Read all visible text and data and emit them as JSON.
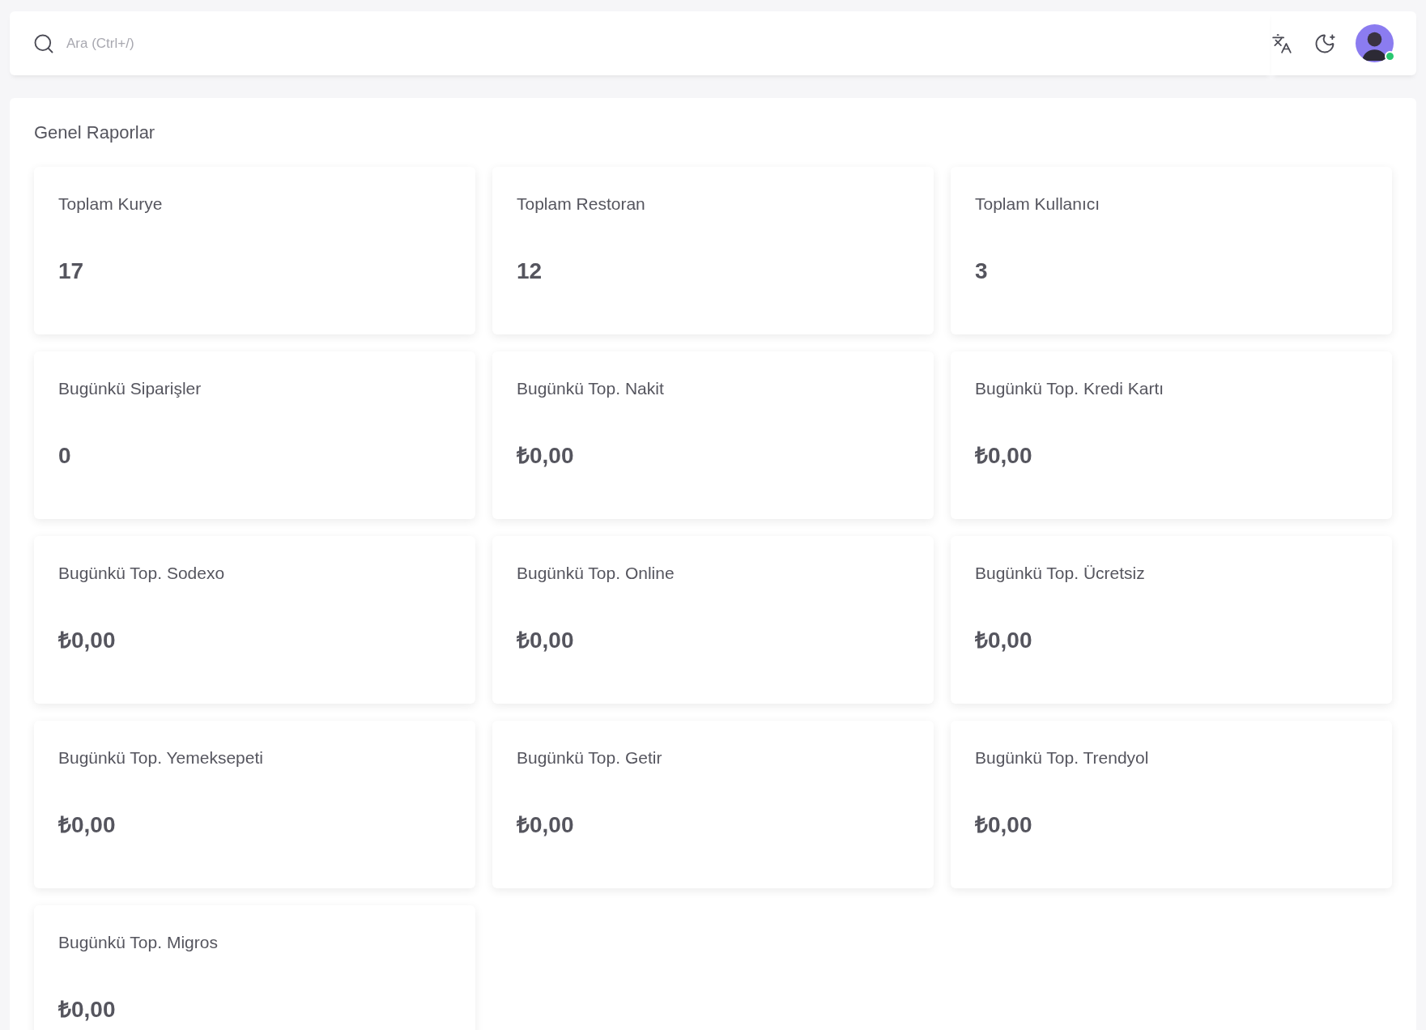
{
  "search": {
    "placeholder": "Ara (Ctrl+/)"
  },
  "user": {
    "online": true
  },
  "section": {
    "title": "Genel Raporlar"
  },
  "cards": [
    {
      "label": "Toplam Kurye",
      "value": "17"
    },
    {
      "label": "Toplam Restoran",
      "value": "12"
    },
    {
      "label": "Toplam Kullanıcı",
      "value": "3"
    },
    {
      "label": "Bugünkü Siparişler",
      "value": "0"
    },
    {
      "label": "Bugünkü Top. Nakit",
      "value": "₺0,00"
    },
    {
      "label": "Bugünkü Top. Kredi Kartı",
      "value": "₺0,00"
    },
    {
      "label": "Bugünkü Top. Sodexo",
      "value": "₺0,00"
    },
    {
      "label": "Bugünkü Top. Online",
      "value": "₺0,00"
    },
    {
      "label": "Bugünkü Top. Ücretsiz",
      "value": "₺0,00"
    },
    {
      "label": "Bugünkü Top. Yemeksepeti",
      "value": "₺0,00"
    },
    {
      "label": "Bugünkü Top. Getir",
      "value": "₺0,00"
    },
    {
      "label": "Bugünkü Top. Trendyol",
      "value": "₺0,00"
    },
    {
      "label": "Bugünkü Top. Migros",
      "value": "₺0,00"
    }
  ]
}
